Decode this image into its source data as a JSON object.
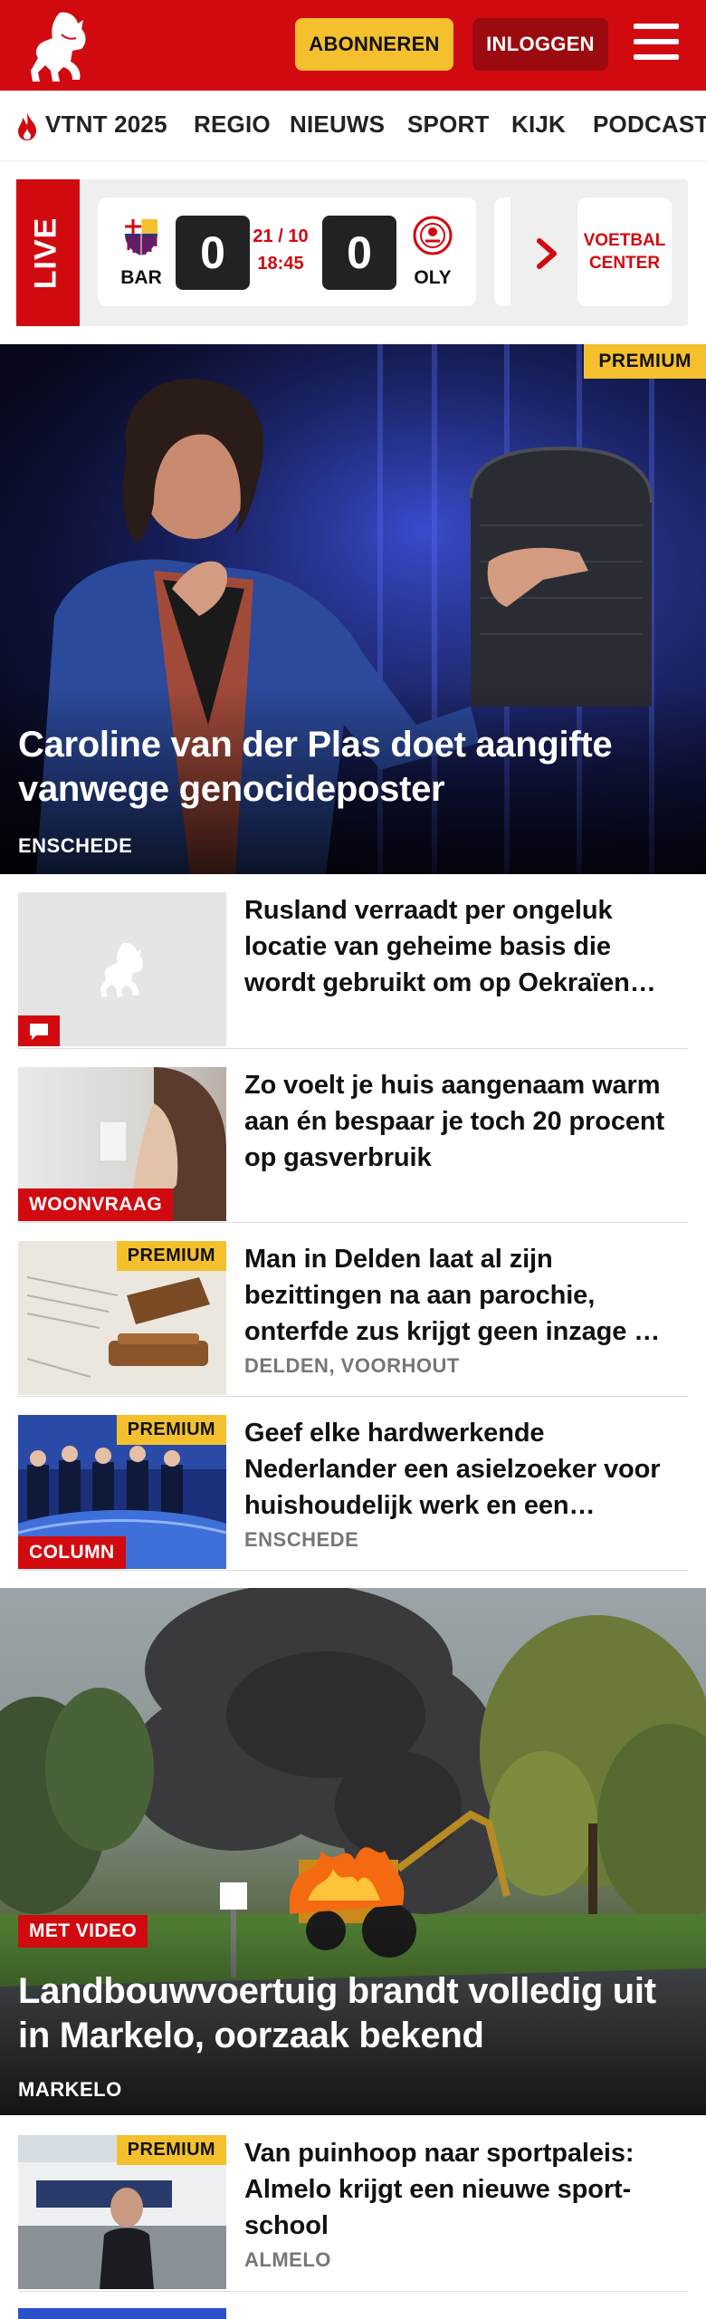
{
  "header": {
    "subscribe_label": "ABONNEREN",
    "login_label": "INLOGGEN",
    "brand_color": "#d10a10",
    "accent_color": "#f5c02e"
  },
  "nav": {
    "items": [
      "VTNT 2025",
      "REGIO",
      "NIEUWS",
      "SPORT",
      "KIJK",
      "PODCAST"
    ]
  },
  "live": {
    "label": "LIVE",
    "match": {
      "home": "BAR",
      "away": "OLY",
      "home_score": "0",
      "away_score": "0",
      "date": "21 / 10",
      "time": "18:45"
    },
    "voetbal_center_label": "VOETBAL CENTER"
  },
  "hero1": {
    "badge": "PREMIUM",
    "title": "Caroline van der Plas doet aangifte vanwege genocideposter",
    "location": "ENSCHEDE"
  },
  "articles": [
    {
      "title": "Rusland verraadt per ongeluk locatie van geheime basis die wordt gebruikt om op Oekraïen…",
      "location": ""
    },
    {
      "title": "Zo voelt je huis aangenaam warm aan én bespaar je toch 20 procent op gasverbruik",
      "badge": "WOONVRAAG",
      "location": ""
    },
    {
      "title": "Man in Delden laat al zijn bezittingen na aan parochie, onterfde zus krijgt geen inzage …",
      "premium": "PREMIUM",
      "location": "DELDEN, VOORHOUT"
    },
    {
      "title": "Geef elke hardwerkende Nederlander een asielzoeker voor huishoudelijk werk en een…",
      "premium": "PREMIUM",
      "badge": "COLUMN",
      "location": "ENSCHEDE"
    }
  ],
  "hero2": {
    "badge": "MET VIDEO",
    "title": "Landbouwvoertuig brandt volledig uit in Markelo, oorzaak bekend",
    "location": "MARKELO"
  },
  "article_after": {
    "title": "Van puinhoop naar sportpaleis: Almelo krijgt een nieuwe sport­school",
    "premium": "PREMIUM",
    "location": "ALMELO"
  }
}
